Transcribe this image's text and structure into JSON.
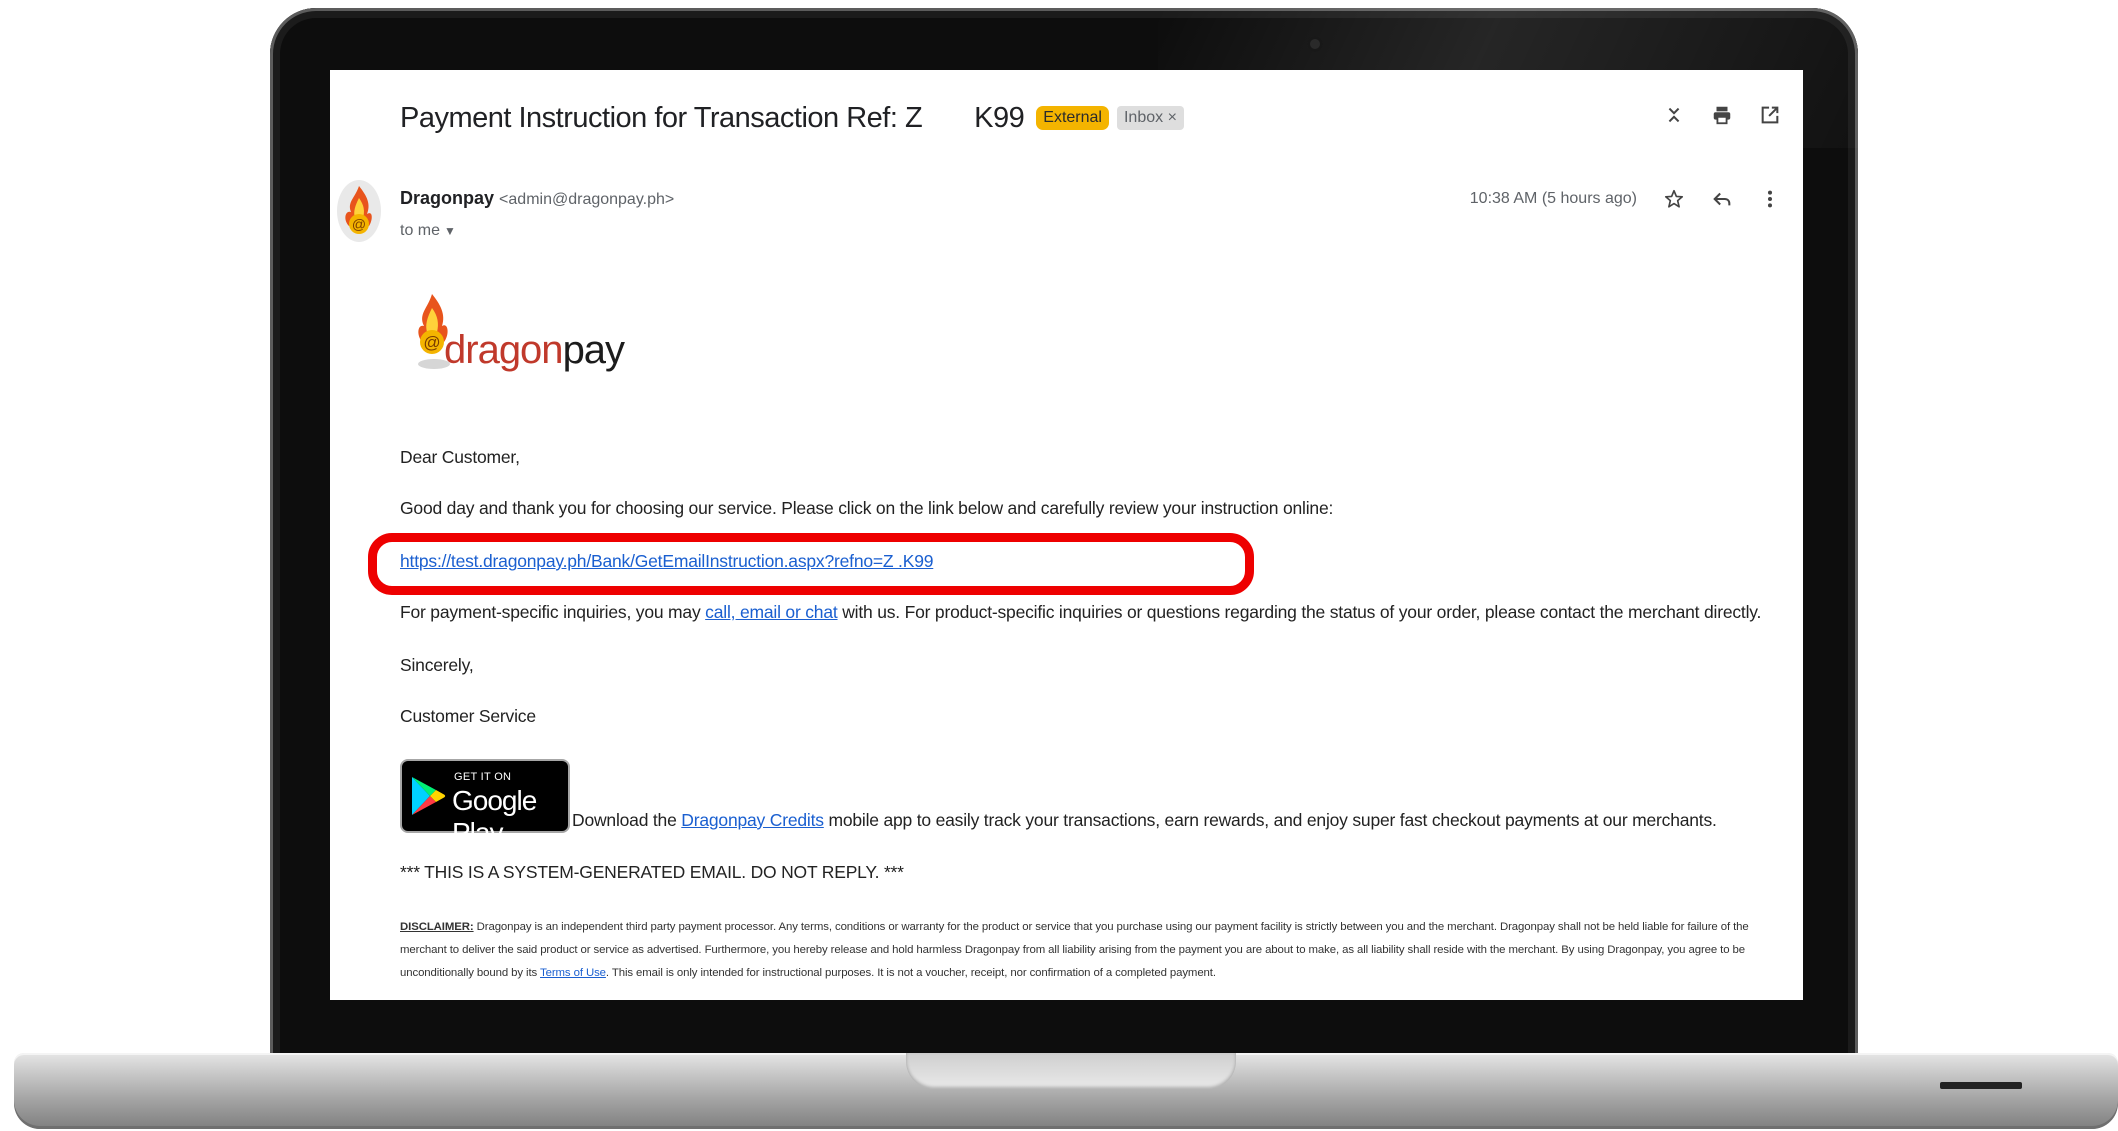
{
  "email": {
    "subject_prefix": "Payment Instruction for Transaction Ref: Z",
    "subject_suffix": "K99",
    "labels": {
      "external": "External",
      "inbox": "Inbox ×"
    },
    "sender_name": "Dragonpay",
    "sender_email": "<admin@dragonpay.ph>",
    "recipient": "to me",
    "timestamp": "10:38 AM (5 hours ago)",
    "toolbar_icons": [
      "collapse-icon",
      "print-icon",
      "open-new-window-icon"
    ],
    "action_icons": [
      "star-icon",
      "reply-icon",
      "more-vert-icon"
    ]
  },
  "body": {
    "logo_part1": "dragon",
    "logo_part2": "pay",
    "greeting": "Dear Customer,",
    "intro": "Good day and thank you for choosing our service. Please click on the link below and carefully review your instruction online:",
    "instruction_link": "https://test.dragonpay.ph/Bank/GetEmailInstruction.aspx?refno=Z        .K99",
    "inquiry_before": "For payment-specific inquiries, you may ",
    "inquiry_link": "call, email or chat",
    "inquiry_after": " with us. For product-specific inquiries or questions regarding the status of your order, please contact the merchant directly.",
    "closing": "Sincerely,",
    "signature": "Customer Service",
    "google_play_small": "GET IT ON",
    "google_play_big": "Google Play",
    "app_before": "Download the ",
    "app_link": "Dragonpay Credits",
    "app_after": " mobile app to easily track your transactions, earn rewards, and enjoy super fast checkout payments at our merchants.",
    "system_notice": "*** THIS IS A SYSTEM-GENERATED EMAIL. DO NOT REPLY. ***",
    "disclaimer_label": "DISCLAIMER:",
    "disclaimer_text": " Dragonpay is an independent third party payment processor. Any terms, conditions or warranty for the product or service that you purchase using our payment facility is strictly between you and the merchant. Dragonpay shall not be held liable for failure of the merchant to deliver the said product or service as advertised. Furthermore, you hereby release and hold harmless Dragonpay from all liability arising from the payment you are about to make, as all liability shall reside with the merchant. By using Dragonpay, you agree to be unconditionally bound by its ",
    "terms_link": "Terms of Use",
    "disclaimer_end": ". This email is only intended for instructional purposes. It is not a voucher, receipt, nor confirmation of a completed payment."
  },
  "colors": {
    "highlight": "#ee0000",
    "external_chip": "#f4b400",
    "link": "#1a5fd0",
    "logo_red": "#c0392b"
  }
}
